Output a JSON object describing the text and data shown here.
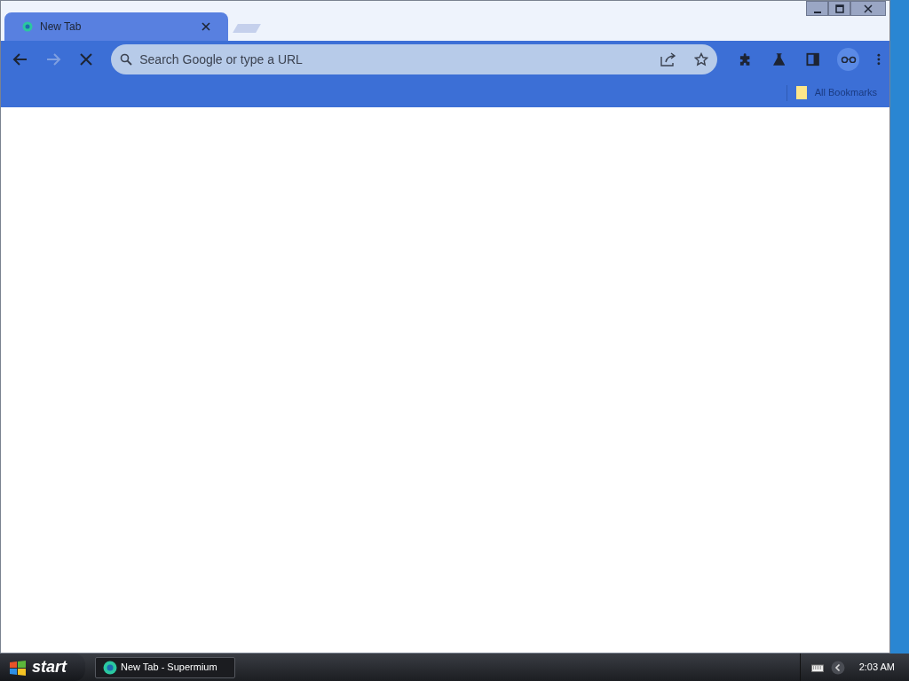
{
  "window": {
    "controls": [
      {
        "kind": "minimize"
      },
      {
        "kind": "maximize"
      },
      {
        "kind": "close"
      }
    ]
  },
  "tabs": [
    {
      "title": "New Tab",
      "selected": true
    }
  ],
  "toolbar": {
    "loading": true,
    "back_enabled": true,
    "forward_enabled": false,
    "omnibox": {
      "placeholder": "Search Google or type a URL"
    }
  },
  "bookmarks_bar": {
    "items": [
      {
        "label": "All Bookmarks"
      }
    ]
  },
  "taskbar": {
    "start": "start",
    "tasks": [
      {
        "label": "New Tab - Supermium",
        "selected": false
      }
    ],
    "clock": "2:03 AM"
  }
}
